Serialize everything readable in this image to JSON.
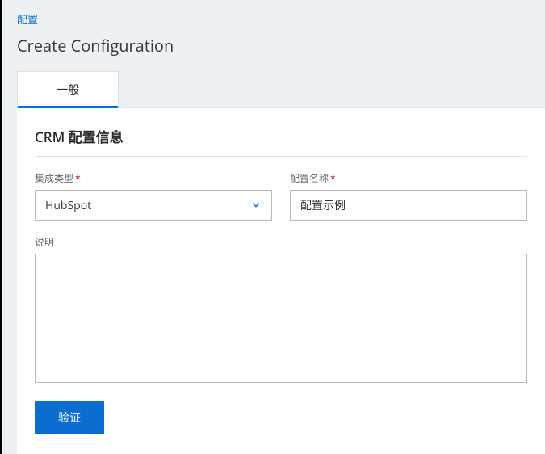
{
  "breadcrumb": {
    "root": "配置"
  },
  "page_title": "Create Configuration",
  "tabs": {
    "general": "一般"
  },
  "section": {
    "title": "CRM 配置信息"
  },
  "fields": {
    "integration_type": {
      "label": "集成类型",
      "value": "HubSpot"
    },
    "config_name": {
      "label": "配置名称",
      "value": "配置示例"
    },
    "description": {
      "label": "说明",
      "value": ""
    }
  },
  "buttons": {
    "verify": "验证"
  }
}
